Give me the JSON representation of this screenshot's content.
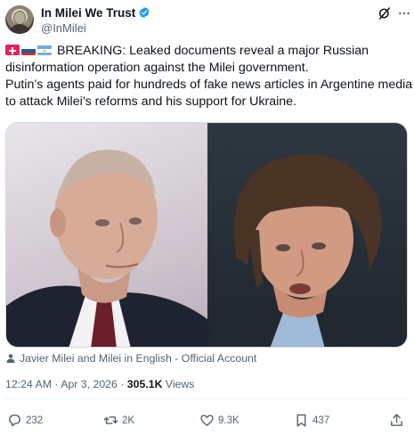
{
  "author": {
    "display_name": "In Milei We Trust",
    "handle": "@InMilei",
    "verified": true
  },
  "tweet": {
    "line1": "BREAKING: Leaked documents reveal a major Russian",
    "line2": "disinformation operation against the Milei government.",
    "line3": "Putin’s agents paid for hundreds of fake news articles in Argentine media",
    "line4": "to attack Milei’s reforms and his support for Ukraine.",
    "flags": [
      "red-alert-emoji",
      "russia-flag-emoji",
      "argentina-flag-emoji"
    ]
  },
  "media": {
    "attribution": "Javier Milei and Milei in English - Official Account"
  },
  "meta": {
    "time": "12:24 AM",
    "separator": "·",
    "date": "Apr 3, 2026",
    "views_count": "305.1K",
    "views_label": "Views"
  },
  "actions": {
    "replies": "232",
    "reposts": "2K",
    "likes": "9.3K",
    "bookmarks": "437"
  },
  "colors": {
    "text": "#0f1419",
    "secondary": "#536471",
    "verified": "#1d9bf0"
  }
}
